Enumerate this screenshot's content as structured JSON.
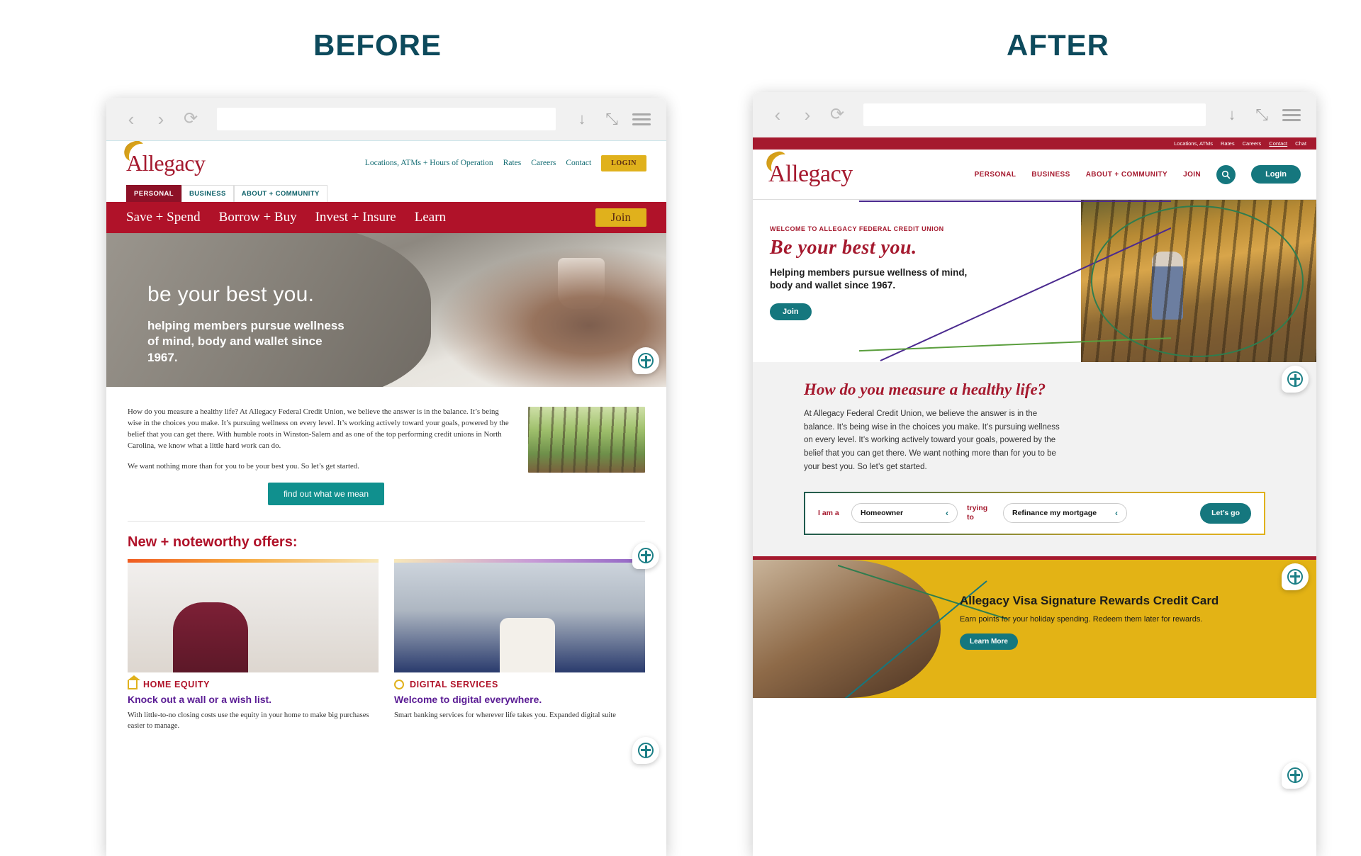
{
  "labels": {
    "before": "BEFORE",
    "after": "AFTER"
  },
  "browser": {
    "back_icon": "‹",
    "forward_icon": "›",
    "reload_icon": "⟳",
    "download_icon": "↓",
    "expand_icon": "⤡",
    "menu_icon": "menu-icon",
    "url_value": "",
    "url_placeholder": ""
  },
  "before": {
    "brand": "Allegacy",
    "utility_links": [
      "Locations, ATMs + Hours of Operation",
      "Rates",
      "Careers",
      "Contact"
    ],
    "login_label": "LOGIN",
    "tabs": [
      {
        "label": "PERSONAL",
        "active": true
      },
      {
        "label": "BUSINESS",
        "active": false
      },
      {
        "label": "ABOUT + COMMUNITY",
        "active": false
      }
    ],
    "mainnav": [
      "Save + Spend",
      "Borrow + Buy",
      "Invest + Insure",
      "Learn"
    ],
    "join_label": "Join",
    "hero": {
      "headline": "be your best you.",
      "subhead": "helping members pursue wellness of mind, body and wallet since 1967."
    },
    "body": {
      "p1": "How do you measure a healthy life? At Allegacy Federal Credit Union, we believe the answer is in the balance. It’s being wise in the choices you make. It’s pursuing wellness on every level. It’s working actively toward your goals, powered by the belief that you can get there. With humble roots in Winston-Salem and as one of the top performing credit unions in North Carolina, we know what a little hard work can do.",
      "p2": "We want nothing more than for you to be your best you. So let’s get started.",
      "cta": "find out what we mean"
    },
    "offers_heading": "New + noteworthy offers:",
    "cards": [
      {
        "category": "HOME EQUITY",
        "icon": "home-icon",
        "title": "Knock out a wall or a wish list.",
        "desc": "With little-to-no closing costs use the equity in your home to make big purchases easier to manage."
      },
      {
        "category": "DIGITAL SERVICES",
        "icon": "circle-icon",
        "title": "Welcome to digital everywhere.",
        "desc": "Smart banking services for wherever life takes you. Expanded digital suite"
      }
    ]
  },
  "after": {
    "brand": "Allegacy",
    "utility_links": [
      "Locations, ATMs",
      "Rates",
      "Careers",
      "Contact",
      "Chat"
    ],
    "nav": [
      "PERSONAL",
      "BUSINESS",
      "ABOUT + COMMUNITY",
      "JOIN"
    ],
    "search_icon": "🔍",
    "login_label": "Login",
    "hero": {
      "kicker": "WELCOME TO ALLEGACY FEDERAL CREDIT UNION",
      "script": "Be your best you.",
      "subhead": "Helping members pursue wellness of mind, body and wallet since 1967.",
      "join_label": "Join"
    },
    "measure": {
      "heading": "How do you measure a healthy life?",
      "paragraph": "At Allegacy Federal Credit Union, we believe the answer is in the balance. It’s being wise in the choices you make. It’s pursuing wellness on every level. It’s working actively toward your goals, powered by the belief that you can get there. We want nothing more than for you to be your best you. So let’s get started.",
      "form": {
        "label_a": "I am a",
        "select_a_value": "Homeowner",
        "label_b": "trying to",
        "select_b_value": "Refinance my mortgage",
        "chevron": "‹",
        "go_label": "Let’s go"
      }
    },
    "promo": {
      "title": "Allegacy Visa Signature Rewards Credit Card",
      "desc": "Earn points for your holiday spending. Redeem them later for rewards.",
      "cta": "Learn More"
    }
  },
  "colors": {
    "brand_red": "#a5192e",
    "nav_red": "#b01229",
    "teal": "#15777e",
    "gold": "#e0b11c",
    "purple": "#5a1c94",
    "title_blue": "#0d4a5c"
  }
}
